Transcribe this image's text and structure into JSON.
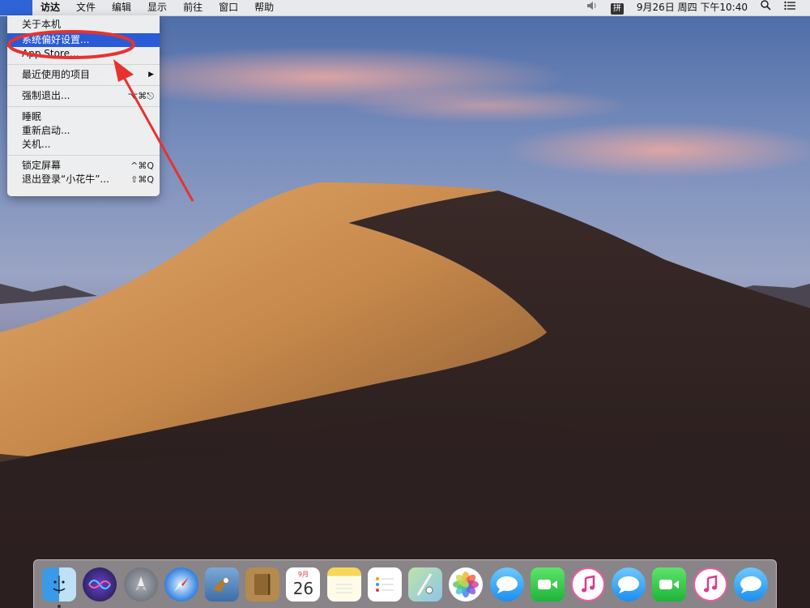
{
  "menubar": {
    "apple_glyph": "",
    "items": [
      "访达",
      "文件",
      "编辑",
      "显示",
      "前往",
      "窗口",
      "帮助"
    ],
    "right": {
      "volume_icon": "speaker-icon",
      "ime": "拼",
      "datetime": "9月26日 周四 下午10:40",
      "search_icon": "spotlight-icon",
      "notification_icon": "notification-center-icon"
    }
  },
  "apple_menu": {
    "about": "关于本机",
    "system_prefs": "系统偏好设置...",
    "app_store": "App Store...",
    "recent": "最近使用的项目",
    "force_quit": "强制退出...",
    "force_quit_shortcut": "⌥⌘⎋",
    "sleep": "睡眠",
    "restart": "重新启动...",
    "shutdown": "关机...",
    "lock": "锁定屏幕",
    "lock_shortcut": "^⌘Q",
    "logout": "退出登录“小花牛”...",
    "logout_shortcut": "⇧⌘Q"
  },
  "dock": {
    "calendar_month": "9月",
    "calendar_day": "26",
    "apps": [
      "finder-icon",
      "siri-icon",
      "launchpad-icon",
      "safari-icon",
      "mail-icon",
      "contacts-icon",
      "calendar-icon",
      "notes-icon",
      "reminders-icon",
      "maps-icon",
      "photos-icon",
      "messages-icon",
      "facetime-icon",
      "itunes-icon",
      "messages-icon",
      "facetime-icon",
      "itunes-icon",
      "messages-icon"
    ]
  },
  "colors": {
    "menu_highlight": "#2a5bd7",
    "annotation_red": "#e8322f"
  }
}
